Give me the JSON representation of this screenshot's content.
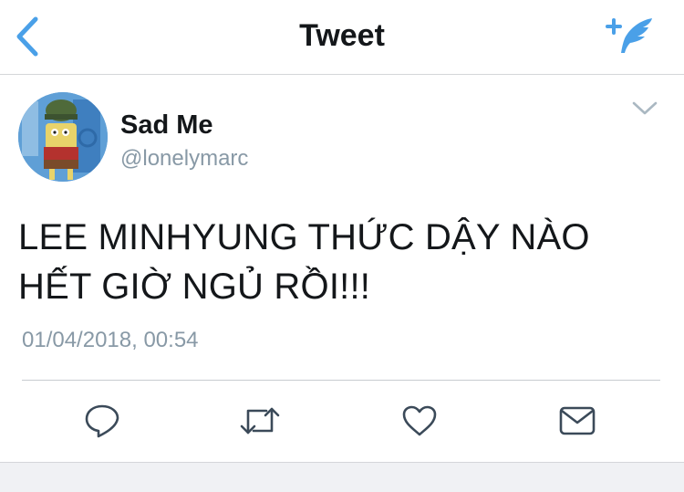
{
  "nav": {
    "title": "Tweet",
    "back_icon": "chevron-left-icon",
    "compose_icon": "compose-tweet-icon"
  },
  "tweet": {
    "author_name": "Sad Me",
    "author_handle": "@lonelymarc",
    "text_line1": "LEE MINHYUNG THỨC DẬY NÀO",
    "text_line2": "HẾT GIỜ NGỦ RỒI!!!",
    "timestamp": "01/04/2018, 00:54",
    "caret_icon": "chevron-down-icon"
  },
  "actions": [
    {
      "icon": "reply-icon"
    },
    {
      "icon": "retweet-icon"
    },
    {
      "icon": "like-icon"
    },
    {
      "icon": "direct-message-icon"
    }
  ],
  "colors": {
    "accent": "#4aa0e8",
    "text": "#14171a",
    "secondary": "#8899a6",
    "icon": "#3b4a59"
  }
}
